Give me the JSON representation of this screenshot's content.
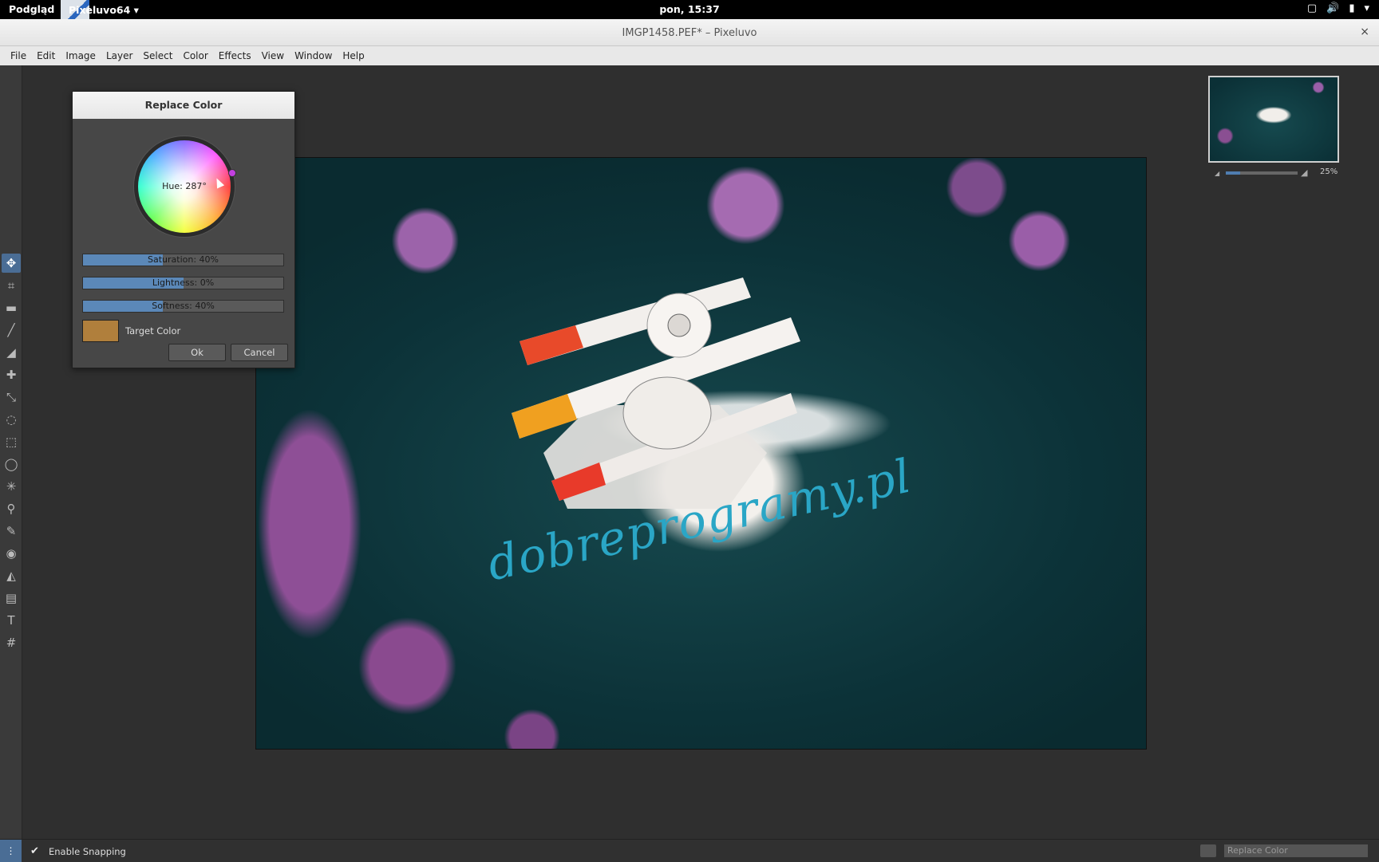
{
  "topbar": {
    "activities": "Podgląd",
    "app_menu": "Pixeluvo64 ▾",
    "clock": "pon, 15:37"
  },
  "window": {
    "title": "IMGP1458.PEF* – Pixeluvo",
    "close": "×"
  },
  "menu": [
    "File",
    "Edit",
    "Image",
    "Layer",
    "Select",
    "Color",
    "Effects",
    "View",
    "Window",
    "Help"
  ],
  "dialog": {
    "title": "Replace Color",
    "hue_label": "Hue: 287°",
    "saturation": {
      "label": "Saturation: 40%",
      "value": 0.4
    },
    "lightness": {
      "label": "Lightness: 0%",
      "value": 0.5
    },
    "softness": {
      "label": "Softness: 40%",
      "value": 0.4
    },
    "target_color_label": "Target Color",
    "target_color": "#b07f3c",
    "ok": "Ok",
    "cancel": "Cancel"
  },
  "canvas": {
    "signature": "dobreprogramy.pl"
  },
  "navigator": {
    "zoom": "25%",
    "zoom_level": 0.2
  },
  "statusbar": {
    "snapping_label": "Enable Snapping",
    "history_label": "Replace Color"
  },
  "tools": [
    "move-tool",
    "crop-tool",
    "stamp-tool",
    "brush-tool",
    "eraser-tool",
    "heal-tool",
    "smudge-tool",
    "lasso-tool",
    "rect-select-tool",
    "ellipse-select-tool",
    "magic-wand-tool",
    "eyedropper-tool",
    "pen-tool",
    "red-eye-tool",
    "bucket-tool",
    "gradient-tool",
    "text-tool",
    "transform-tool"
  ]
}
